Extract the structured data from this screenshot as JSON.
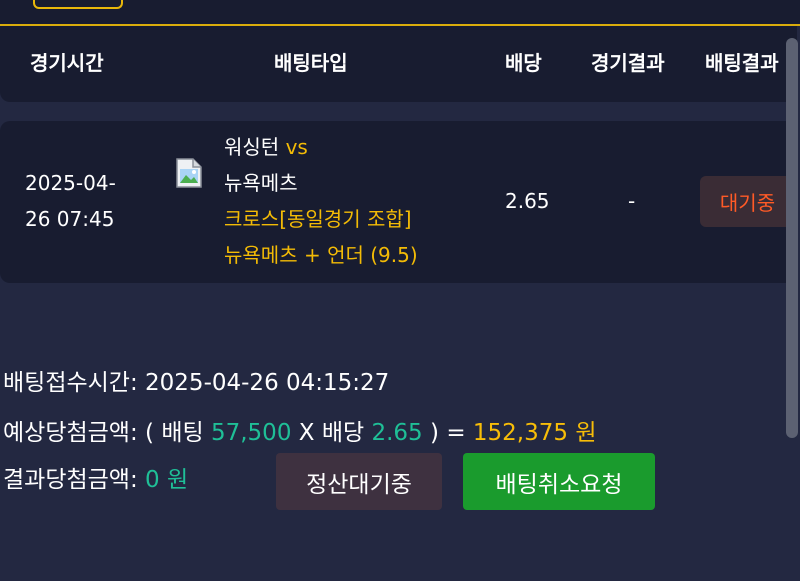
{
  "table": {
    "headers": {
      "time": "경기시간",
      "type": "배팅타입",
      "odds": "배당",
      "result": "경기결과",
      "bet_result": "배팅결과"
    },
    "row": {
      "time_line1": "2025-04-",
      "time_line2": "26 07:45",
      "team_home": "워싱턴",
      "vs": "vs",
      "team_away": "뉴욕메츠",
      "bet_type": "크로스[동일경기 조합]",
      "pick": "뉴욕메츠 + 언더 (9.5)",
      "odds": "2.65",
      "result": "-",
      "status": "대기중"
    }
  },
  "summary": {
    "received_label": "배팅접수시간:",
    "received_value": "2025-04-26 04:15:27",
    "expected_label": "예상당첨금액:",
    "open_paren": "(",
    "bet_label": "배팅",
    "bet_amount": "57,500",
    "multiply": "X",
    "odds_label": "배당",
    "odds_value": "2.65",
    "close_paren": ")",
    "equals": "=",
    "expected_amount": "152,375 원",
    "result_label": "결과당첨금액:",
    "result_amount": "0 원"
  },
  "buttons": {
    "pending_label": "정산대기중",
    "cancel_label": "배팅취소요청"
  },
  "icons": {
    "broken_image": "broken-image-icon"
  },
  "colors": {
    "background": "#232841",
    "panel": "#181c30",
    "gold_accent": "#f3bb06",
    "teal": "#1fbf97",
    "status_orange": "#ff5a26",
    "cancel_green": "#1a9b2d"
  }
}
